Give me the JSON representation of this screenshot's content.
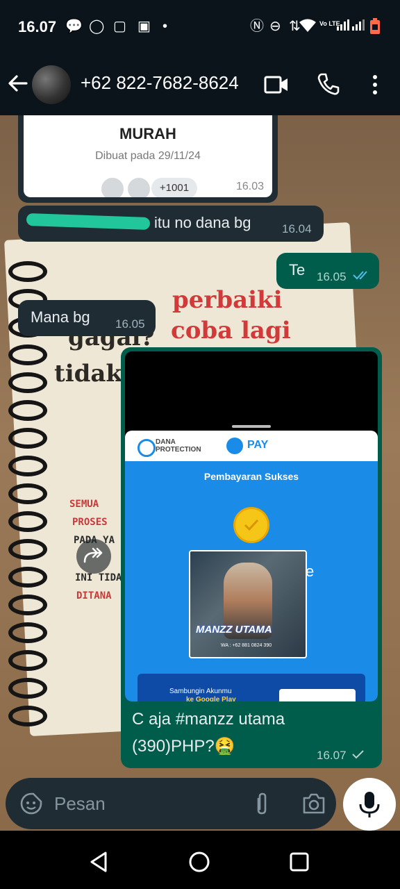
{
  "status": {
    "time": "16.07",
    "network_label": "Vo LTE"
  },
  "header": {
    "contact": "+62 822-7682-8624"
  },
  "poll": {
    "title": "MURAH",
    "created": "Dibuat pada 29/11/24",
    "count": "+1001",
    "time": "16.03"
  },
  "messages": [
    {
      "text": "itu no dana bg",
      "time": "16.04",
      "direction": "in"
    },
    {
      "text": "Te",
      "time": "16.05",
      "direction": "out"
    },
    {
      "text": "Mana bg",
      "time": "16.05",
      "direction": "in"
    }
  ],
  "image_message": {
    "app_brand": "DANA PROTECTION",
    "pay_label": "PAY",
    "success_text": "Pembayaran Sukses",
    "image_caption": "MANZZ UTAMA",
    "image_wa": "WA : +62 881 0824 390",
    "banner_text": "Sambungin Akunmu",
    "banner_sub": "ke Google Play",
    "caption_line1": "C aja #manzz utama",
    "caption_line2": "(390)PHP?🤮",
    "time": "16.07"
  },
  "wallpaper_text": {
    "red1": "perbaiki",
    "red2": "coba lagi",
    "dark1": "gagal?",
    "dark2": "tidak",
    "small1": "SEMUA",
    "small2": "PROSES",
    "small3": "PADA YA",
    "small4": "INI TIDA",
    "small5": "DITANA"
  },
  "input": {
    "placeholder": "Pesan"
  },
  "colors": {
    "header_bg": "#0b141a",
    "incoming": "#1f2c34",
    "outgoing": "#005c4b",
    "read_tick": "#53bdeb"
  }
}
